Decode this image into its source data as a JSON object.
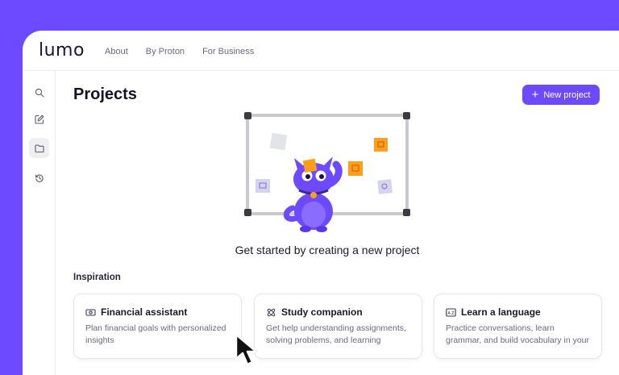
{
  "brand": {
    "logo": "lumo"
  },
  "nav": [
    "About",
    "By Proton",
    "For Business"
  ],
  "sidebar": {
    "items": [
      {
        "icon": "search-icon"
      },
      {
        "icon": "edit-icon"
      },
      {
        "icon": "folder-icon",
        "active": true
      },
      {
        "icon": "history-icon"
      }
    ]
  },
  "page": {
    "title": "Projects",
    "new_button": "New project",
    "empty_message": "Get started by creating a new project",
    "inspiration_heading": "Inspiration"
  },
  "cards": [
    {
      "icon": "money-icon",
      "title": "Financial assistant",
      "description": "Plan financial goals with personalized insights"
    },
    {
      "icon": "atom-icon",
      "title": "Study companion",
      "description": "Get help understanding assignments, solving problems, and learning conce..."
    },
    {
      "icon": "translate-icon",
      "title": "Learn a language",
      "description": "Practice conversations, learn grammar, and build vocabulary in your target la..."
    }
  ],
  "colors": {
    "accent": "#6d4aff",
    "background": "#ffffff",
    "sticky_note": "#ff9d1d"
  }
}
